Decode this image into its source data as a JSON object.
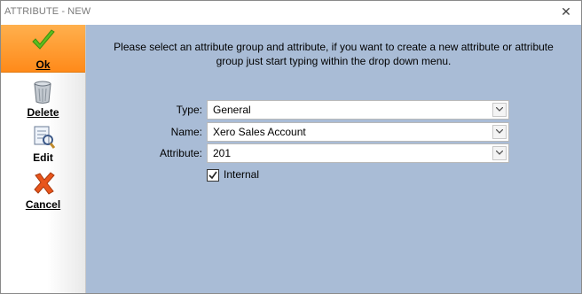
{
  "window": {
    "title": "ATTRIBUTE - NEW",
    "close_glyph": "✕"
  },
  "sidebar": {
    "ok": {
      "label": "Ok",
      "icon": "checkmark-icon"
    },
    "delete": {
      "label": "Delete",
      "icon": "trash-icon"
    },
    "edit": {
      "label": "Edit",
      "icon": "edit-document-icon"
    },
    "cancel": {
      "label": "Cancel",
      "icon": "cancel-x-icon"
    }
  },
  "form": {
    "instructions_line1": "Please select an attribute group and attribute, if you want to create a new attribute or attribute",
    "instructions_line2": "group just start typing within the drop down menu.",
    "type_label": "Type:",
    "type_value": "General",
    "name_label": "Name:",
    "name_value": "Xero Sales Account",
    "attribute_label": "Attribute:",
    "attribute_value": "201",
    "internal_label": "Internal",
    "internal_checked": true
  },
  "colors": {
    "main_background": "#a9bcd6",
    "ok_highlight": "#ff9a2a",
    "accept_green": "#5cbf1e",
    "cancel_orange": "#e8551c"
  }
}
